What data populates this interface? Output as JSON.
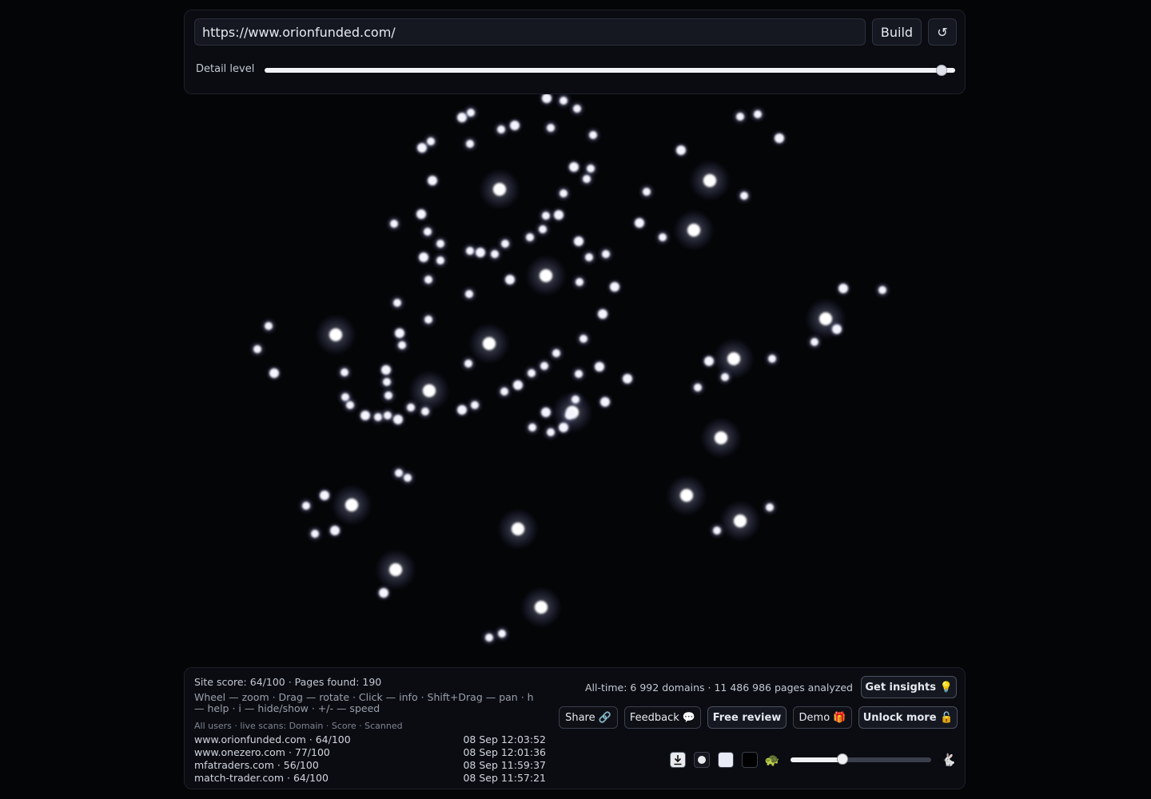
{
  "top": {
    "url_value": "https://www.orionfunded.com/",
    "build_label": "Build",
    "reset_glyph": "↺",
    "detail_label": "Detail level",
    "detail_level": 0.98
  },
  "bottom": {
    "score_line": "Site score: 64/100 · Pages found: 190",
    "help_line": "Wheel — zoom · Drag — rotate · Click — info · Shift+Drag — pan · h — help · i — hide/show · +/- — speed",
    "feed_header": "All users · live scans: Domain · Score · Scanned",
    "feed": [
      {
        "domain": "www.orionfunded.com · 64/100",
        "time": "08 Sep 12:03:52"
      },
      {
        "domain": "www.onezero.com · 77/100",
        "time": "08 Sep 12:01:36"
      },
      {
        "domain": "mfatraders.com · 56/100",
        "time": "08 Sep 11:59:37"
      },
      {
        "domain": "match-trader.com · 64/100",
        "time": "08 Sep 11:57:21"
      }
    ],
    "stats": "All-time: 6 992 domains · 11 486 986 pages analyzed",
    "buttons": {
      "insights": "Get insights 💡",
      "share": "Share 🔗",
      "feedback": "Feedback 💬",
      "review": "Free review",
      "demo": "Demo 🎁",
      "unlock": "Unlock more 🔓"
    },
    "tools": {
      "download_icon": "download-icon",
      "small_dot_icon": "small-dot-icon",
      "white_square_icon": "white-swatch-icon",
      "black_square_icon": "black-swatch-icon",
      "slow_glyph": "🐢",
      "fast_glyph": "🐇"
    },
    "speed_level": 0.37
  },
  "colors": {
    "background": "#040507",
    "node": "#ffffff",
    "panel": "#0a0c11"
  }
}
